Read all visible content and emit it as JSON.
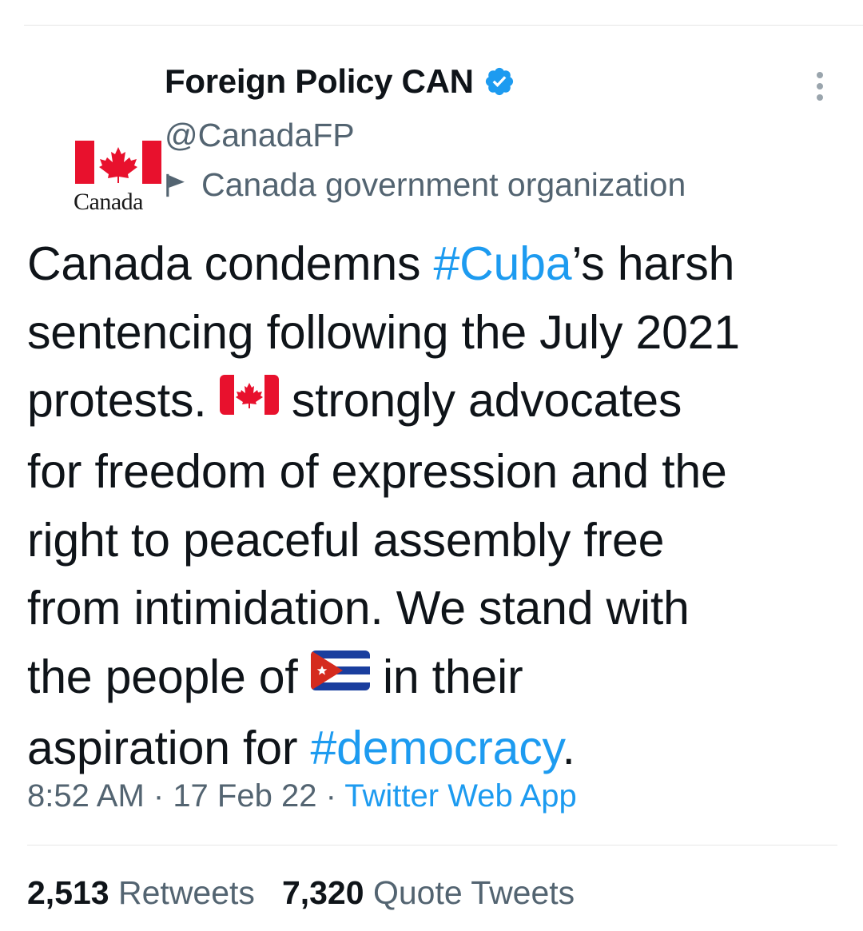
{
  "account": {
    "display_name": "Foreign Policy CAN",
    "handle": "@CanadaFP",
    "affiliation": "Canada government organization",
    "avatar_wordmark": "Canada",
    "verified_icon": "verified-badge-icon",
    "affiliation_icon": "flag-icon"
  },
  "tweet": {
    "lines": [
      {
        "parts": [
          {
            "t": "text",
            "v": "Canada condemns "
          },
          {
            "t": "tag",
            "v": "#Cuba"
          },
          {
            "t": "text",
            "v": "’s harsh"
          }
        ]
      },
      {
        "parts": [
          {
            "t": "text",
            "v": "sentencing following the July 2021"
          }
        ]
      },
      {
        "parts": [
          {
            "t": "text",
            "v": "protests. "
          },
          {
            "t": "emoji",
            "v": "canada-flag-emoji"
          },
          {
            "t": "text",
            "v": " strongly advocates"
          }
        ]
      },
      {
        "parts": [
          {
            "t": "text",
            "v": "for freedom of expression and the"
          }
        ]
      },
      {
        "parts": [
          {
            "t": "text",
            "v": "right to peaceful assembly free"
          }
        ]
      },
      {
        "parts": [
          {
            "t": "text",
            "v": "from intimidation. We stand with"
          }
        ]
      },
      {
        "parts": [
          {
            "t": "text",
            "v": "the people of "
          },
          {
            "t": "emoji",
            "v": "cuba-flag-emoji"
          },
          {
            "t": "text",
            "v": " in their"
          }
        ]
      },
      {
        "parts": [
          {
            "t": "text",
            "v": "aspiration for "
          },
          {
            "t": "tag",
            "v": "#democracy"
          },
          {
            "t": "text",
            "v": "."
          }
        ]
      }
    ]
  },
  "meta": {
    "time": "8:52 AM",
    "separator": " · ",
    "date": "17 Feb 22",
    "source": "Twitter Web App"
  },
  "stats": {
    "retweets_count": "2,513",
    "retweets_label": "Retweets",
    "quotes_count": "7,320",
    "quotes_label": "Quote Tweets"
  },
  "colors": {
    "link": "#1d9bf0",
    "secondary": "#536471",
    "primary": "#0f1419",
    "canada_red": "#e8112d",
    "verified": "#1d9bf0"
  }
}
